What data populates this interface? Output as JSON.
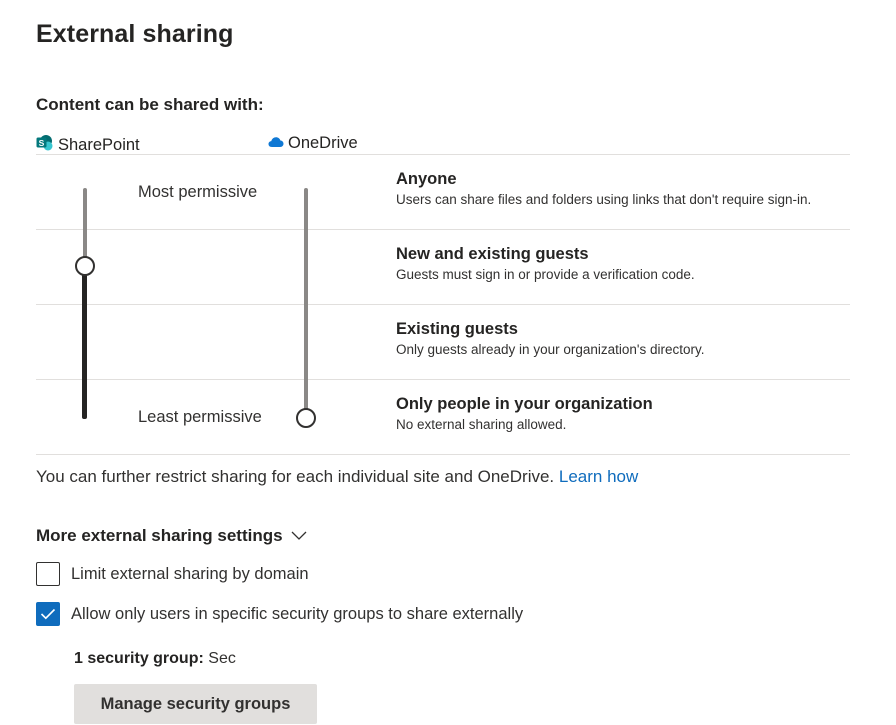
{
  "page": {
    "title": "External sharing"
  },
  "sharing": {
    "subhead": "Content can be shared with:",
    "sharepoint_label": "SharePoint",
    "onedrive_label": "OneDrive",
    "most_permissive": "Most permissive",
    "least_permissive": "Least permissive",
    "levels": [
      {
        "title": "Anyone",
        "desc": "Users can share files and folders using links that don't require sign-in."
      },
      {
        "title": "New and existing guests",
        "desc": "Guests must sign in or provide a verification code."
      },
      {
        "title": "Existing guests",
        "desc": "Only guests already in your organization's directory."
      },
      {
        "title": "Only people in your organization",
        "desc": "No external sharing allowed."
      }
    ],
    "sharepoint_level": "New and existing guests",
    "onedrive_level": "Only people in your organization",
    "note_text": "You can further restrict sharing for each individual site and OneDrive.",
    "note_link": "Learn how"
  },
  "more_settings": {
    "label": "More external sharing settings",
    "checkboxes": [
      {
        "label": "Limit external sharing by domain",
        "checked": false
      },
      {
        "label": "Allow only users in specific security groups to share externally",
        "checked": true
      }
    ],
    "security_group_label": "1 security group:",
    "security_group_value": "Sec",
    "manage_button": "Manage security groups"
  },
  "colors": {
    "accent": "#0f6cbd",
    "sharepoint": "#038387",
    "onedrive": "#0f78d4"
  }
}
